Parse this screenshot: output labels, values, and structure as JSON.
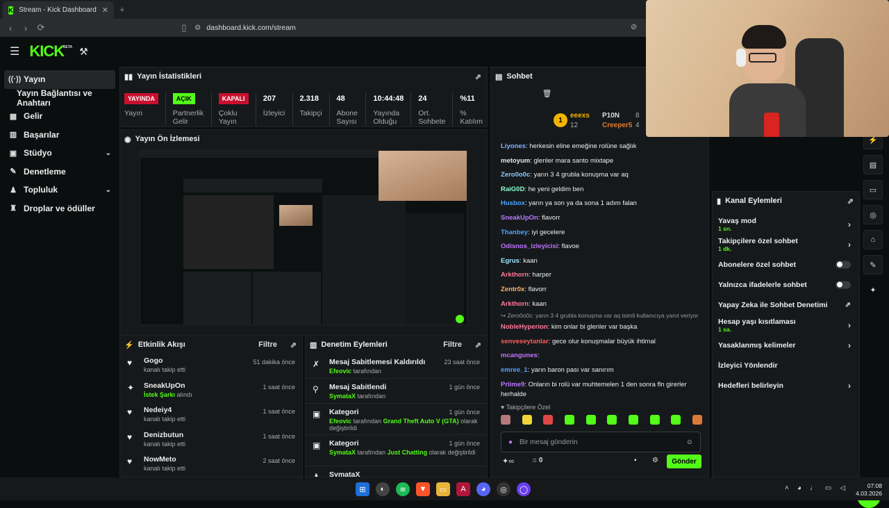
{
  "browser": {
    "tab_title": "Stream - Kick Dashboard",
    "tab_close": "✕",
    "new_tab": "+",
    "url": "dashboard.kick.com/stream"
  },
  "topnav": {
    "logo": "KICK",
    "logo_tag": "BETA"
  },
  "sidebar": {
    "items": [
      {
        "label": "Yayın"
      },
      {
        "label": "Yayın Bağlantısı ve Anahtarı"
      },
      {
        "label": "Gelir"
      },
      {
        "label": "Başarılar"
      },
      {
        "label": "Stüdyo"
      },
      {
        "label": "Denetleme"
      },
      {
        "label": "Topluluk"
      },
      {
        "label": "Droplar ve ödüller"
      }
    ]
  },
  "stats_panel": {
    "title": "Yayın İstatistikleri",
    "items": [
      {
        "value": "YAYINDA",
        "label": "Yayın"
      },
      {
        "value": "AÇIK",
        "label": "Partnerlik Gelir"
      },
      {
        "value": "KAPALI",
        "label": "Çoklu Yayın"
      },
      {
        "value": "207",
        "label": "İzleyici"
      },
      {
        "value": "2.318",
        "label": "Takipçi"
      },
      {
        "value": "48",
        "label": "Abone Sayısı"
      },
      {
        "value": "10:44:48",
        "label": "Yayında Olduğu"
      },
      {
        "value": "24",
        "label": "Ort. Sohbete"
      },
      {
        "value": "%11",
        "label": "% Katılım"
      }
    ]
  },
  "preview_panel": {
    "title": "Yayın Ön İzlemesi"
  },
  "activity_panel": {
    "title": "Etkinlik Akışı",
    "filter": "Filtre",
    "items": [
      {
        "name": "Gogo",
        "desc": "kanalı takip etti",
        "time": "51 dakika önce"
      },
      {
        "name": "SneakUpOn",
        "highlight": "İstek Şarkı",
        "desc": "alındı",
        "time": "1 saat önce"
      },
      {
        "name": "Nedeiy4",
        "desc": "kanalı takip etti",
        "time": "1 saat önce"
      },
      {
        "name": "Denizbutun",
        "desc": "kanalı takip etti",
        "time": "1 saat önce"
      },
      {
        "name": "NowMeto",
        "desc": "kanalı takip etti",
        "time": "2 saat önce"
      }
    ]
  },
  "mod_panel": {
    "title": "Denetim Eylemleri",
    "filter": "Filtre",
    "items": [
      {
        "title": "Mesaj Sabitlemesi Kaldırıldı",
        "user": "Efeovic",
        "rest": "tarafından",
        "time": "23 saat önce"
      },
      {
        "title": "Mesaj Sabitlendi",
        "user": "SymataX",
        "rest": "tarafından",
        "time": "1 gün önce"
      },
      {
        "title": "Kategori",
        "user": "Efeovic",
        "rest": "tarafından",
        "game": "Grand Theft Auto V (GTA)",
        "rest2": "olarak değiştirildi",
        "time": "1 gün önce"
      },
      {
        "title": "Kategori",
        "user": "SymataX",
        "rest": "tarafından",
        "game": "Just Chatting",
        "rest2": "olarak değiştirildi",
        "time": "1 gün önce"
      },
      {
        "title": "SymataX",
        "time": ""
      }
    ]
  },
  "chat": {
    "title": "Sohbet",
    "leaders": [
      {
        "name": "eeexs",
        "count": "12"
      },
      {
        "name": "P10N",
        "count": "8"
      },
      {
        "name": "Creeper5",
        "count": "4"
      }
    ],
    "messages": [
      {
        "user": "Liyones",
        "color": "#7fb3ff",
        "text": "herkesin eline emeğine rolüne sağlık"
      },
      {
        "user": "metoyum",
        "color": "#e6e6e6",
        "text": "glenler mara santo mixtape"
      },
      {
        "user": "Zero0o0c",
        "color": "#8ecbff",
        "text": "yarın 3 4 grubla konuşma var aq"
      },
      {
        "user": "RaiG0D",
        "color": "#8bffd0",
        "text": "he yeni geldim ben"
      },
      {
        "user": "Husbox",
        "color": "#4da3ff",
        "text": "yarın ya son ya da sona 1 adım falan"
      },
      {
        "user": "SneakUpOn",
        "color": "#b77bff",
        "text": "flavorr"
      },
      {
        "user": "Thanbey",
        "color": "#4da3ff",
        "text": "iyi gecelere"
      },
      {
        "user": "Odisnos_izleyicisi",
        "color": "#c074ff",
        "text": "flavoe"
      },
      {
        "user": "Egrus",
        "color": "#9be9ff",
        "text": "kaan"
      },
      {
        "user": "Arkthorn",
        "color": "#ff7a9a",
        "text": "harper"
      },
      {
        "user": "Zentr0x",
        "color": "#ffb36b",
        "text": "flavorr"
      },
      {
        "user": "Arkthorn",
        "color": "#ff7a9a",
        "text": "kaan"
      }
    ],
    "reply_note": "↪ Zero0o0c: yarın 3 4 grubla konuşma var aq isimli kullanıcıya yanıt veriyor",
    "messages2": [
      {
        "user": "NobleHyperion",
        "color": "#ff7a9a",
        "text": "kim onlar bi glenler var başka"
      },
      {
        "user": "senveseytanlar",
        "color": "#ff5c5c",
        "text": "gece olur konuşmalar büyük ihtimal"
      },
      {
        "user": "mcangunes",
        "color": "#c074ff",
        "text": ""
      },
      {
        "user": "emree_1",
        "color": "#4da3ff",
        "text": "yarın baron pası var sanırım"
      },
      {
        "user": "Priime9",
        "color": "#c074ff",
        "text": "Onların bi rolü var muhtemelen 1 den sonra fln girerler herhalde"
      }
    ],
    "followers_only": "Takipçilere Özel",
    "input_placeholder": "Bir mesaj gönderin",
    "points": "0",
    "send": "Gönder"
  },
  "actions_panel": {
    "title": "Kanal Eylemleri",
    "items": [
      {
        "label": "Yavaş mod",
        "sub": "1 sn.",
        "control": "chevron"
      },
      {
        "label": "Takipçilere özel sohbet",
        "sub": "1 dk.",
        "control": "chevron"
      },
      {
        "label": "Abonelere özel sohbet",
        "control": "toggle"
      },
      {
        "label": "Yalnızca ifadelerle sohbet",
        "control": "toggle"
      },
      {
        "label": "Yapay Zeka ile Sohbet Denetimi",
        "control": "external"
      },
      {
        "label": "Hesap yaşı kısıtlaması",
        "sub": "1 sa.",
        "control": "chevron"
      },
      {
        "label": "Yasaklanmış kelimeler",
        "control": "chevron"
      },
      {
        "label": "İzleyici Yönlendir",
        "control": "none"
      },
      {
        "label": "Hedefleri belirleyin",
        "control": "chevron"
      }
    ]
  },
  "taskbar": {
    "time": "07:08",
    "date": "4.03.2026"
  }
}
